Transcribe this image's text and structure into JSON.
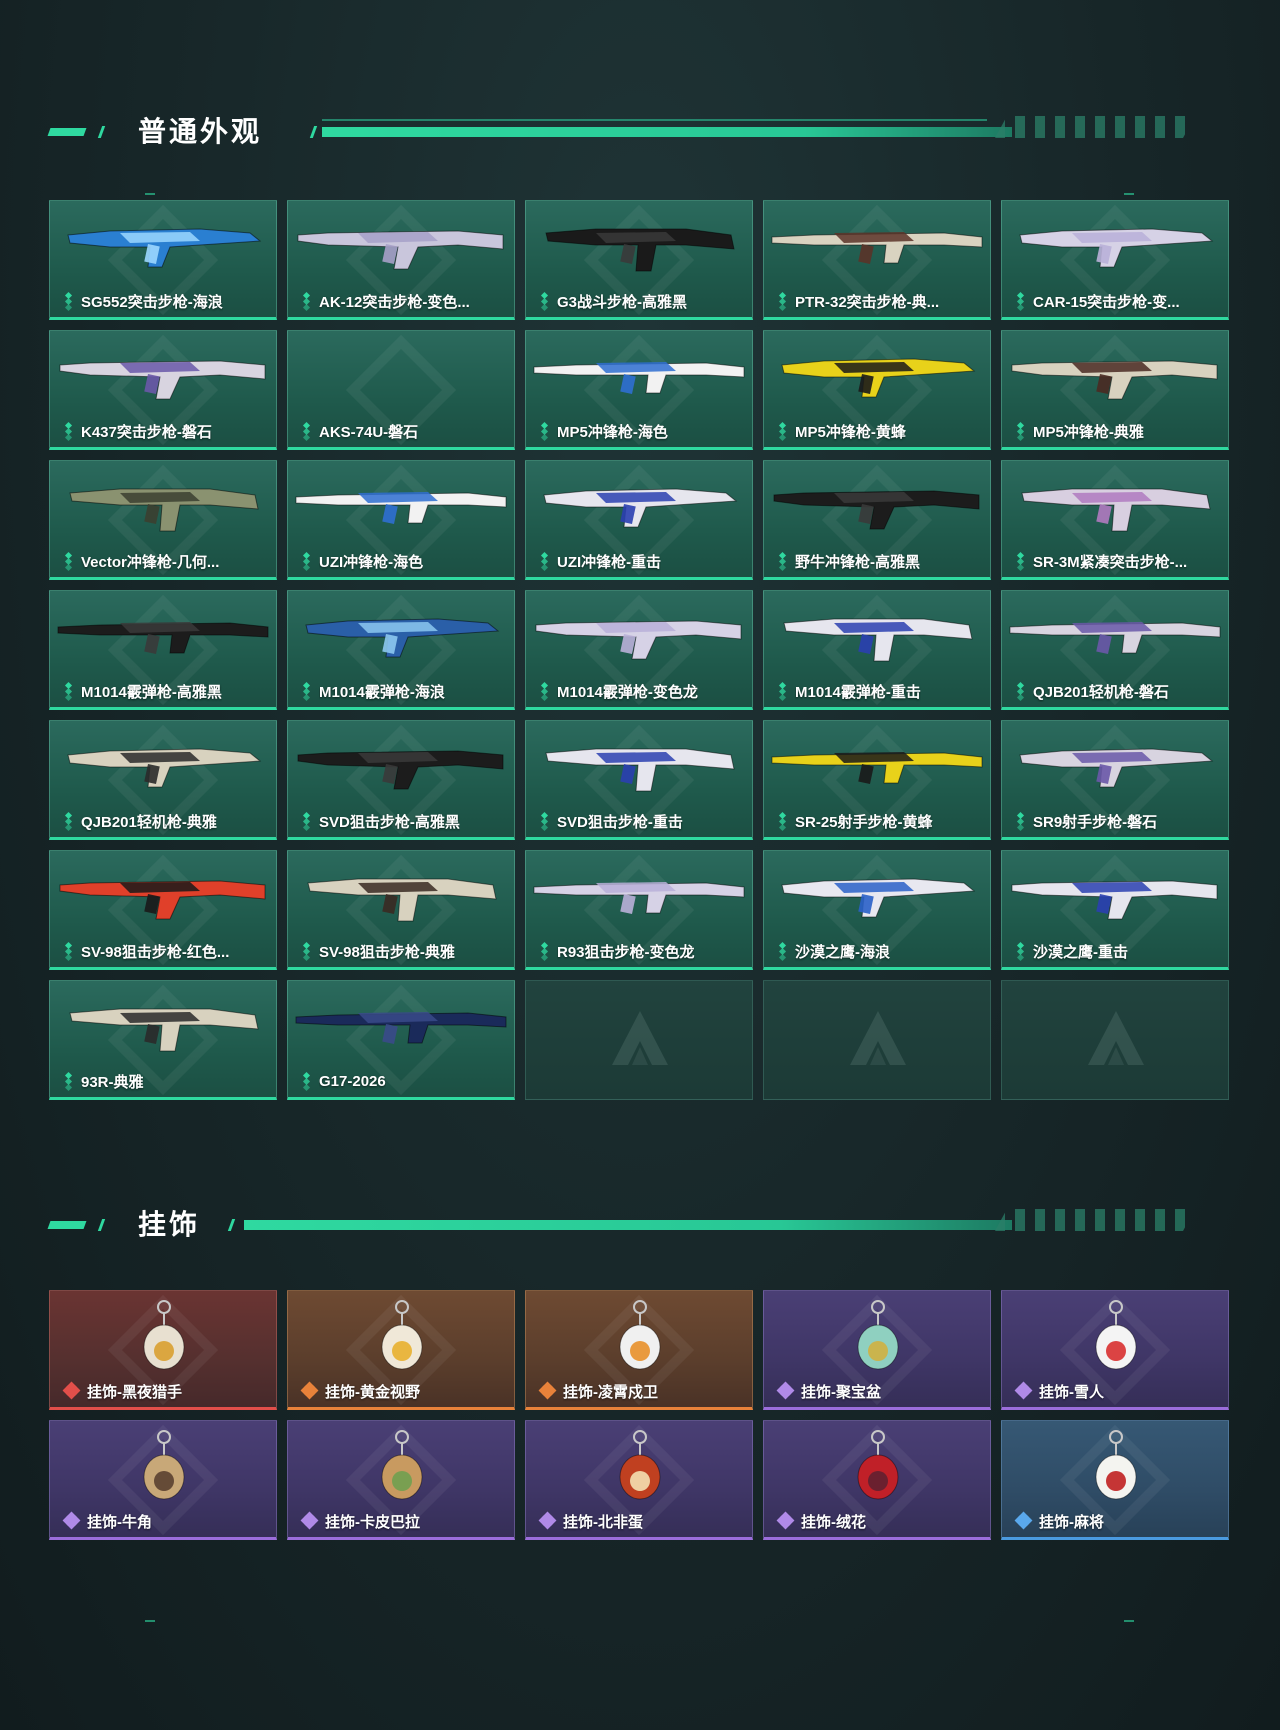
{
  "sections": {
    "weapons": {
      "title": "普通外观",
      "items": [
        {
          "label": "SG552突击步枪-海浪",
          "colors": [
            "#2a7fd1",
            "#9bd7ff"
          ]
        },
        {
          "label": "AK-12突击步枪-变色...",
          "colors": [
            "#c9c6dc",
            "#a6a0c8"
          ]
        },
        {
          "label": "G3战斗步枪-高雅黑",
          "colors": [
            "#1a1a1a",
            "#3a3a3a"
          ]
        },
        {
          "label": "PTR-32突击步枪-典...",
          "colors": [
            "#d9d3c0",
            "#5a3328"
          ]
        },
        {
          "label": "CAR-15突击步枪-变...",
          "colors": [
            "#d6d2e6",
            "#b9b0d8"
          ]
        },
        {
          "label": "K437突击步枪-磐石",
          "colors": [
            "#d8d4e0",
            "#6a58a8"
          ]
        },
        {
          "label": "AKS-74U-磐石",
          "colors": [
            "#2b6a5d",
            "#2b6a5d"
          ],
          "blank": true
        },
        {
          "label": "MP5冲锋枪-海色",
          "colors": [
            "#f2f2f2",
            "#2f6fd1"
          ]
        },
        {
          "label": "MP5冲锋枪-黄蜂",
          "colors": [
            "#e8d21a",
            "#1a1a1a"
          ]
        },
        {
          "label": "MP5冲锋枪-典雅",
          "colors": [
            "#d8d2bf",
            "#4a2a22"
          ]
        },
        {
          "label": "Vector冲锋枪-几何...",
          "colors": [
            "#8a9270",
            "#3b3f30"
          ]
        },
        {
          "label": "UZI冲锋枪-海色",
          "colors": [
            "#f2f2f2",
            "#2f6fd1"
          ]
        },
        {
          "label": "UZI冲锋枪-重击",
          "colors": [
            "#e6e6ee",
            "#2a3fb0"
          ]
        },
        {
          "label": "野牛冲锋枪-高雅黑",
          "colors": [
            "#1c1c1c",
            "#3a3a3a"
          ]
        },
        {
          "label": "SR-3M紧凑突击步枪-...",
          "colors": [
            "#d8cfe0",
            "#b07ac0"
          ]
        },
        {
          "label": "M1014霰弹枪-高雅黑",
          "colors": [
            "#1c1c1c",
            "#3a3a3a"
          ]
        },
        {
          "label": "M1014霰弹枪-海浪",
          "colors": [
            "#2a5fa8",
            "#8cc8f0"
          ]
        },
        {
          "label": "M1014霰弹枪-变色龙",
          "colors": [
            "#d6d2e6",
            "#b9b0d8"
          ]
        },
        {
          "label": "M1014霰弹枪-重击",
          "colors": [
            "#e6e6ee",
            "#2a3fb0"
          ]
        },
        {
          "label": "QJB201轻机枪-磐石",
          "colors": [
            "#d8d4e0",
            "#6a58a8"
          ]
        },
        {
          "label": "QJB201轻机枪-典雅",
          "colors": [
            "#d8d2bf",
            "#2a2a2a"
          ]
        },
        {
          "label": "SVD狙击步枪-高雅黑",
          "colors": [
            "#1c1c1c",
            "#3a3a3a"
          ]
        },
        {
          "label": "SVD狙击步枪-重击",
          "colors": [
            "#e6e6ee",
            "#2a3fb0"
          ]
        },
        {
          "label": "SR-25射手步枪-黄蜂",
          "colors": [
            "#e8d21a",
            "#1a1a1a"
          ]
        },
        {
          "label": "SR9射手步枪-磐石",
          "colors": [
            "#d8d4e0",
            "#6a58a8"
          ]
        },
        {
          "label": "SV-98狙击步枪-红色...",
          "colors": [
            "#e0402a",
            "#1a1a1a"
          ]
        },
        {
          "label": "SV-98狙击步枪-典雅",
          "colors": [
            "#d8d2bf",
            "#3a2a22"
          ]
        },
        {
          "label": "R93狙击步枪-变色龙",
          "colors": [
            "#d6d2e6",
            "#b9b0d8"
          ]
        },
        {
          "label": "沙漠之鹰-海浪",
          "colors": [
            "#e8e8f0",
            "#2a60c8"
          ]
        },
        {
          "label": "沙漠之鹰-重击",
          "colors": [
            "#e6e6ee",
            "#2a3fb0"
          ]
        },
        {
          "label": "93R-典雅",
          "colors": [
            "#d8d2bf",
            "#2a2a2a"
          ]
        },
        {
          "label": "G17-2026",
          "colors": [
            "#1a2a5a",
            "#3a4a8a"
          ]
        }
      ],
      "empty_slots": 3
    },
    "charms": {
      "title": "挂饰",
      "items": [
        {
          "label": "挂饰-黑夜猎手",
          "rarity": "red",
          "colors": [
            "#e8e0d0",
            "#d9a030"
          ]
        },
        {
          "label": "挂饰-黄金视野",
          "rarity": "gold",
          "colors": [
            "#f0e8d8",
            "#e8b030"
          ]
        },
        {
          "label": "挂饰-凌霄戍卫",
          "rarity": "gold",
          "colors": [
            "#f0f0f0",
            "#e8902a"
          ]
        },
        {
          "label": "挂饰-聚宝盆",
          "rarity": "purple",
          "colors": [
            "#8fd0c0",
            "#d0b040"
          ]
        },
        {
          "label": "挂饰-雪人",
          "rarity": "purple",
          "colors": [
            "#f4f4f4",
            "#d83030"
          ]
        },
        {
          "label": "挂饰-牛角",
          "rarity": "purple",
          "colors": [
            "#c8a878",
            "#5a4030"
          ]
        },
        {
          "label": "挂饰-卡皮巴拉",
          "rarity": "purple",
          "colors": [
            "#c89a60",
            "#70a050"
          ]
        },
        {
          "label": "挂饰-北非蛋",
          "rarity": "purple",
          "colors": [
            "#c04020",
            "#f4e0b0"
          ]
        },
        {
          "label": "挂饰-绒花",
          "rarity": "purple",
          "colors": [
            "#c02028",
            "#602030"
          ]
        },
        {
          "label": "挂饰-麻将",
          "rarity": "blue",
          "colors": [
            "#f4f4f0",
            "#c02020"
          ]
        }
      ]
    }
  }
}
